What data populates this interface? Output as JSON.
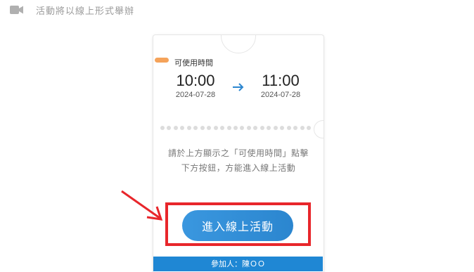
{
  "notice": {
    "icon": "video-camera-icon",
    "text": "活動將以線上形式舉辦"
  },
  "ticket": {
    "available_label": "可使用時間",
    "start": {
      "time": "10:00",
      "date": "2024-07-28"
    },
    "end": {
      "time": "11:00",
      "date": "2024-07-28"
    },
    "arrow_icon": "arrow-right-icon",
    "instruction": "請於上方顯示之「可使用時間」點擊下方按鈕，方能進入線上活動",
    "enter_button_label": "進入線上活動",
    "participant": "參加人：陳ＯＯ"
  },
  "colors": {
    "accent_orange": "#f5a35a",
    "primary_blue": "#2b86cf",
    "annotation_red": "#e8262b"
  },
  "annotation": {
    "arrow_icon": "red-arrow-icon"
  }
}
